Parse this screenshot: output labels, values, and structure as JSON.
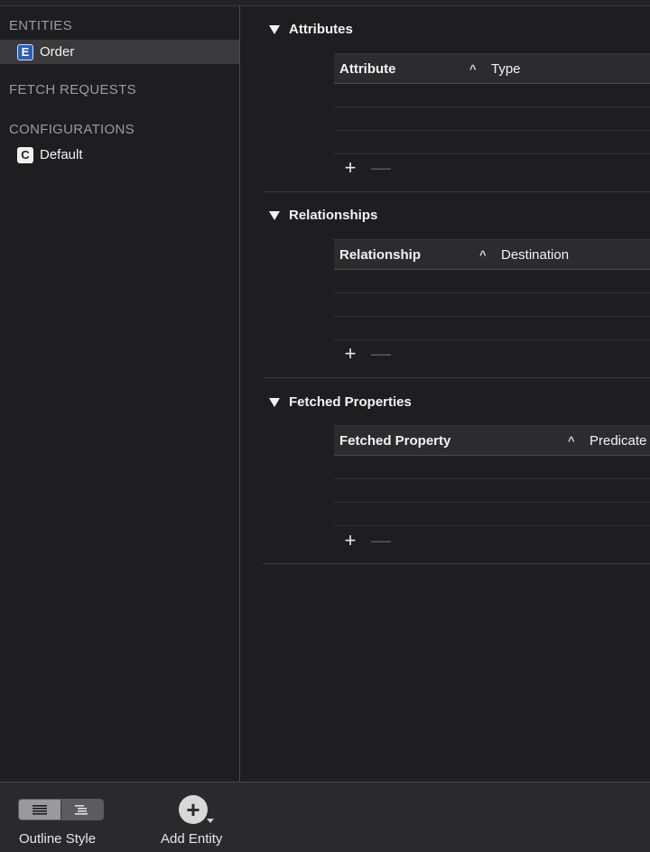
{
  "sidebar": {
    "entities_header": "ENTITIES",
    "entities": [
      {
        "badge": "E",
        "label": "Order"
      }
    ],
    "fetch_requests_header": "FETCH REQUESTS",
    "configurations_header": "CONFIGURATIONS",
    "configurations": [
      {
        "badge": "C",
        "label": "Default"
      }
    ]
  },
  "sections": {
    "attributes": {
      "title": "Attributes",
      "col1": "Attribute",
      "col2": "Type"
    },
    "relationships": {
      "title": "Relationships",
      "col1": "Relationship",
      "col2": "Destination"
    },
    "fetched": {
      "title": "Fetched Properties",
      "col1": "Fetched Property",
      "col2": "Predicate"
    }
  },
  "controls": {
    "plus": "+",
    "minus": "—",
    "caret": "^"
  },
  "bottombar": {
    "outline_style_label": "Outline Style",
    "add_entity_label": "Add Entity",
    "add_symbol": "+"
  },
  "colors": {
    "background": "#1e1e20",
    "entity_badge": "#2a5fb8",
    "selection": "#3a3a3d"
  }
}
